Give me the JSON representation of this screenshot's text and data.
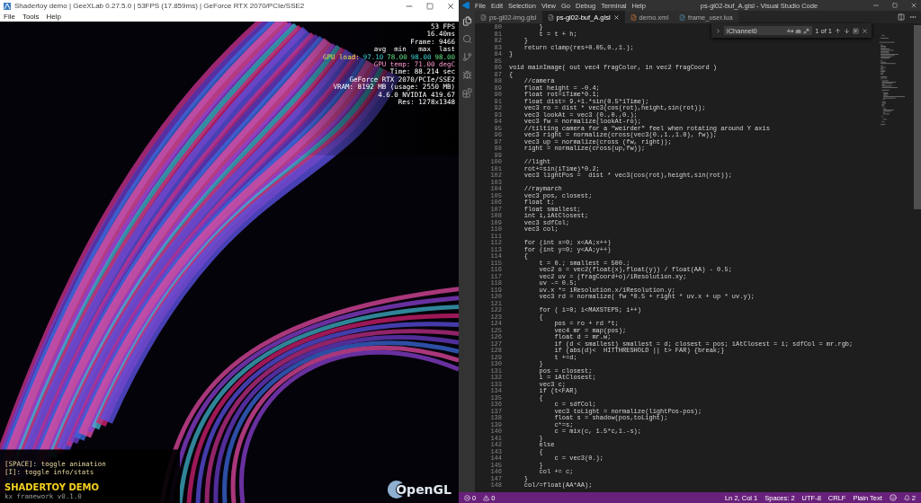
{
  "shader_window": {
    "title": "Shadertoy demo | GeeXLab 0.27.5.0 | 53FPS (17.859ms) | GeForce RTX 2070/PCIe/SSE2",
    "menu": [
      "File",
      "Tools",
      "Help"
    ],
    "stats": [
      {
        "kind": "plain",
        "text": "53 FPS"
      },
      {
        "kind": "plain",
        "text": "16.40ms"
      },
      {
        "kind": "plain",
        "text": "Frame: 9466"
      },
      {
        "kind": "plain",
        "text": "avg  min   max  last"
      },
      {
        "kind": "load",
        "label": "GPU load:",
        "values": [
          "97.10",
          "78.00",
          "98.00",
          "98.00"
        ]
      },
      {
        "kind": "temp",
        "text": "GPU temp: 71.00 degC"
      },
      {
        "kind": "plain",
        "text": "Time: 88.214 sec"
      },
      {
        "kind": "plain",
        "text": "GeForce RTX 2070/PCIe/SSE2"
      },
      {
        "kind": "plain",
        "text": "VRAM: 8192 MB (usage: 2550 MB)"
      },
      {
        "kind": "plain",
        "text": "4.6.0 NVIDIA 419.67"
      },
      {
        "kind": "plain",
        "text": "Res: 1278x1348"
      }
    ],
    "hints": [
      "[SPACE]: toggle animation",
      "[I]: toggle info/stats"
    ],
    "demo_title": "SHADERTOY DEMO",
    "framework": "kx framework v0.1.0",
    "logo_text": "OpenGL"
  },
  "editor": {
    "menu": [
      "File",
      "Edit",
      "Selection",
      "View",
      "Go",
      "Debug",
      "Terminal",
      "Help"
    ],
    "title": "ps-gl02-buf_A.glsl - Visual Studio Code",
    "tabs": [
      {
        "label": "ps-gl02-img.glsl",
        "selected": false,
        "kind": "glsl"
      },
      {
        "label": "ps-gl02-buf_A.glsl",
        "selected": true,
        "kind": "glsl"
      },
      {
        "label": "demo.xml",
        "selected": false,
        "kind": "xml"
      },
      {
        "label": "frame_user.lua",
        "selected": false,
        "kind": "lua"
      }
    ],
    "find": {
      "value": "iChannel0",
      "result": "1 of 1"
    },
    "lines": [
      {
        "n": "80",
        "code": "        }"
      },
      {
        "n": "81",
        "code": "        t = t + h;"
      },
      {
        "n": "82",
        "code": "    }"
      },
      {
        "n": "83",
        "code": "    return clamp(res+0.05,0.,1.);"
      },
      {
        "n": "84",
        "code": "}"
      },
      {
        "n": "85"
      },
      {
        "n": "86",
        "code": "void mainImage( out vec4 fragColor, in vec2 fragCoord )"
      },
      {
        "n": "87",
        "code": "{"
      },
      {
        "n": "88",
        "code": "    //camera"
      },
      {
        "n": "89",
        "code": "    float height = -0.4;"
      },
      {
        "n": "90",
        "code": "    float rot=iTime*0.1;"
      },
      {
        "n": "91",
        "code": "    float dist= 9.+1.*sin(0.5*iTime);"
      },
      {
        "n": "92",
        "code": "    vec3 ro = dist * vec3(cos(rot),height,sin(rot));"
      },
      {
        "n": "93",
        "code": "    vec3 lookAt = vec3 (0.,0.,0.);"
      },
      {
        "n": "94",
        "code": "    vec3 fw = normalize(lookAt-ro);"
      },
      {
        "n": "95",
        "code": "    //tilting camera for a \"weirder\" feel when rotating around Y axis"
      },
      {
        "n": "96",
        "code": "    vec3 right = normalize(cross(vec3(0.,1.,1.0), fw));"
      },
      {
        "n": "97",
        "code": "    vec3 up = normalize(cross (fw, right));"
      },
      {
        "n": "98",
        "code": "    right = normalize(cross(up,fw));"
      },
      {
        "n": "99"
      },
      {
        "n": "100",
        "code": "    //light"
      },
      {
        "n": "101",
        "code": "    rot+=sin(iTime)*0.2;"
      },
      {
        "n": "102",
        "code": "    vec3 lightPos =  dist * vec3(cos(rot),height,sin(rot));"
      },
      {
        "n": "103"
      },
      {
        "n": "104",
        "code": "    //raymarch"
      },
      {
        "n": "105",
        "code": "    vec3 pos, closest;"
      },
      {
        "n": "106",
        "code": "    float t;"
      },
      {
        "n": "107",
        "code": "    float smallest;"
      },
      {
        "n": "108",
        "code": "    int i,iAtClosest;"
      },
      {
        "n": "109",
        "code": "    vec3 sdfCol;"
      },
      {
        "n": "110",
        "code": "    vec3 col;"
      },
      {
        "n": "111"
      },
      {
        "n": "112",
        "code": "    for (int x=0; x<AA;x++)"
      },
      {
        "n": "113",
        "code": "    for (int y=0; y<AA;y++)"
      },
      {
        "n": "114",
        "code": "    {"
      },
      {
        "n": "115",
        "code": "        t = 0.; smallest = 500.;"
      },
      {
        "n": "116",
        "code": "        vec2 o = vec2(float(x),float(y)) / float(AA) - 0.5;"
      },
      {
        "n": "117",
        "code": "        vec2 uv = (fragCoord+o)/iResolution.xy;"
      },
      {
        "n": "118",
        "code": "        uv -= 0.5;"
      },
      {
        "n": "119",
        "code": "        uv.x *= iResolution.x/iResolution.y;"
      },
      {
        "n": "120",
        "code": "        vec3 rd = normalize( fw *0.5 + right * uv.x + up * uv.y);"
      },
      {
        "n": "121"
      },
      {
        "n": "122",
        "code": "        for ( i=0; i<MAXSTEPS; i++)"
      },
      {
        "n": "123",
        "code": "        {"
      },
      {
        "n": "124",
        "code": "            pos = ro + rd *t;"
      },
      {
        "n": "125",
        "code": "            vec4 mr = map(pos);"
      },
      {
        "n": "126",
        "code": "            float d = mr.w;"
      },
      {
        "n": "127",
        "code": "            if (d < smallest) smallest = d; closest = pos; iAtClosest = i; sdfCol = mr.rgb;"
      },
      {
        "n": "128",
        "code": "            if (abs(d)<  HITTHRESHOLD || t> FAR) {break;}"
      },
      {
        "n": "129",
        "code": "            t +=d;"
      },
      {
        "n": "130",
        "code": "        }"
      },
      {
        "n": "131",
        "code": "        pos = closest;"
      },
      {
        "n": "132",
        "code": "        i = iAtClosest;"
      },
      {
        "n": "133",
        "code": "        vec3 c;"
      },
      {
        "n": "134",
        "code": "        if (t<FAR)"
      },
      {
        "n": "135",
        "code": "        {"
      },
      {
        "n": "136",
        "code": "            c = sdfCol;"
      },
      {
        "n": "137",
        "code": "            vec3 toLight = normalize(lightPos-pos);"
      },
      {
        "n": "138",
        "code": "            float s = shadow(pos,toLight);"
      },
      {
        "n": "139",
        "code": "            c*=s;"
      },
      {
        "n": "140",
        "code": "            c = mix(c, 1.5*c,1.-s);"
      },
      {
        "n": "141",
        "code": "        }"
      },
      {
        "n": "142",
        "code": "        else"
      },
      {
        "n": "143",
        "code": "        {"
      },
      {
        "n": "144",
        "code": "            c = vec3(0.);"
      },
      {
        "n": "145",
        "code": "        }"
      },
      {
        "n": "146",
        "code": "        col += c;"
      },
      {
        "n": "147",
        "code": "    }"
      },
      {
        "n": "148",
        "code": "    col/=float(AA*AA);"
      }
    ],
    "status_bar": {
      "errors": "0",
      "warnings": "0",
      "items": [
        "Ln 2, Col 1",
        "Spaces: 2",
        "UTF-8",
        "CRLF",
        "Plain Text"
      ],
      "notifications": "2"
    }
  }
}
